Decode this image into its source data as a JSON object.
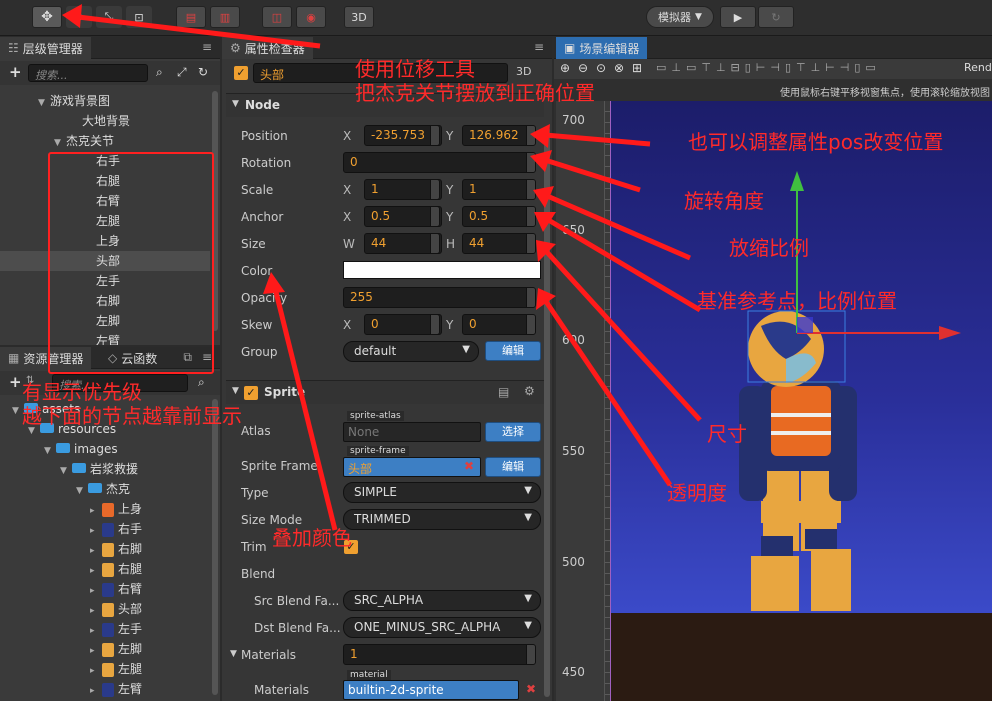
{
  "toolbar": {
    "mode_3d": "3D",
    "simulator": "模拟器",
    "play_icon": "play-icon",
    "refresh_icon": "refresh-icon"
  },
  "hierarchy": {
    "tab_title": "层级管理器",
    "search_placeholder": "搜索...",
    "items": [
      {
        "label": "游戏背景图",
        "level": 1,
        "expanded": true
      },
      {
        "label": "大地背景",
        "level": 2
      },
      {
        "label": "杰克关节",
        "level": 1,
        "expanded": true
      },
      {
        "label": "右手",
        "level": 2
      },
      {
        "label": "右腿",
        "level": 2
      },
      {
        "label": "右臂",
        "level": 2
      },
      {
        "label": "左腿",
        "level": 2
      },
      {
        "label": "上身",
        "level": 2
      },
      {
        "label": "头部",
        "level": 2,
        "selected": true
      },
      {
        "label": "左手",
        "level": 2
      },
      {
        "label": "右脚",
        "level": 2
      },
      {
        "label": "左脚",
        "level": 2
      },
      {
        "label": "左臂",
        "level": 2
      }
    ]
  },
  "assets": {
    "tab_title": "资源管理器",
    "tab_cloud": "云函数",
    "search_placeholder": "搜索...",
    "items": [
      {
        "label": "assets",
        "level": 0,
        "type": "folder"
      },
      {
        "label": "resources",
        "level": 1,
        "type": "folder"
      },
      {
        "label": "images",
        "level": 2,
        "type": "folder"
      },
      {
        "label": "岩浆救援",
        "level": 3,
        "type": "folder"
      },
      {
        "label": "杰克",
        "level": 4,
        "type": "folder"
      },
      {
        "label": "上身",
        "level": 5,
        "type": "sprite",
        "color": "#e8692a"
      },
      {
        "label": "右手",
        "level": 5,
        "type": "sprite",
        "color": "#2a3a8a"
      },
      {
        "label": "右脚",
        "level": 5,
        "type": "sprite",
        "color": "#e8a640"
      },
      {
        "label": "右腿",
        "level": 5,
        "type": "sprite",
        "color": "#e8a640"
      },
      {
        "label": "右臂",
        "level": 5,
        "type": "sprite",
        "color": "#2a3a8a"
      },
      {
        "label": "头部",
        "level": 5,
        "type": "sprite",
        "color": "#e8a640"
      },
      {
        "label": "左手",
        "level": 5,
        "type": "sprite",
        "color": "#2a3a8a"
      },
      {
        "label": "左脚",
        "level": 5,
        "type": "sprite",
        "color": "#e8a640"
      },
      {
        "label": "左腿",
        "level": 5,
        "type": "sprite",
        "color": "#e8a640"
      },
      {
        "label": "左臂",
        "level": 5,
        "type": "sprite",
        "color": "#2a3a8a"
      }
    ]
  },
  "inspector": {
    "tab_title": "属性检查器",
    "node_name": "头部",
    "mode_3d": "3D",
    "node_section": "Node",
    "position": {
      "label": "Position",
      "x": "-235.753",
      "y": "126.962"
    },
    "rotation": {
      "label": "Rotation",
      "value": "0"
    },
    "scale": {
      "label": "Scale",
      "x": "1",
      "y": "1"
    },
    "anchor": {
      "label": "Anchor",
      "x": "0.5",
      "y": "0.5"
    },
    "size": {
      "label": "Size",
      "w": "44",
      "h": "44"
    },
    "color": {
      "label": "Color",
      "value": "#ffffff"
    },
    "opacity": {
      "label": "Opacity",
      "value": "255"
    },
    "skew": {
      "label": "Skew",
      "x": "0",
      "y": "0"
    },
    "group": {
      "label": "Group",
      "value": "default",
      "edit": "编辑"
    },
    "axis_x": "X",
    "axis_y": "Y",
    "axis_w": "W",
    "axis_h": "H",
    "sprite_section": "Sprite",
    "atlas": {
      "label": "Atlas",
      "tag": "sprite-atlas",
      "value": "None",
      "btn": "选择"
    },
    "sprite_frame": {
      "label": "Sprite Frame",
      "tag": "sprite-frame",
      "value": "头部",
      "btn": "编辑"
    },
    "type": {
      "label": "Type",
      "value": "SIMPLE"
    },
    "size_mode": {
      "label": "Size Mode",
      "value": "TRIMMED"
    },
    "trim": {
      "label": "Trim"
    },
    "blend": {
      "label": "Blend"
    },
    "src_blend": {
      "label": "Src Blend Fa...",
      "value": "SRC_ALPHA"
    },
    "dst_blend": {
      "label": "Dst Blend Fa...",
      "value": "ONE_MINUS_SRC_ALPHA"
    },
    "materials": {
      "label": "Materials",
      "value": "1"
    },
    "material_item": {
      "label": "Materials",
      "tag": "material",
      "value": "builtin-2d-sprite"
    }
  },
  "scene": {
    "tab_title": "场景编辑器",
    "hint": "使用鼠标右键平移视窗焦点，使用滚轮缩放视图",
    "render_label": "Rend",
    "ruler": [
      "700",
      "650",
      "600",
      "550",
      "500",
      "450"
    ],
    "bg_top": "#1c1d6a",
    "bg_bottom": "#3b4ac8"
  },
  "annotations": {
    "move_tool_1": "使用位移工具",
    "move_tool_2": "把杰克关节摆放到正确位置",
    "pos": "也可以调整属性pos改变位置",
    "rotate": "旋转角度",
    "scale": "放缩比例",
    "anchor": "基准参考点，比例位置",
    "size": "尺寸",
    "opacity": "透明度",
    "color": "叠加颜色",
    "order_1": "有显示优先级",
    "order_2": "越下面的节点越靠前显示"
  }
}
